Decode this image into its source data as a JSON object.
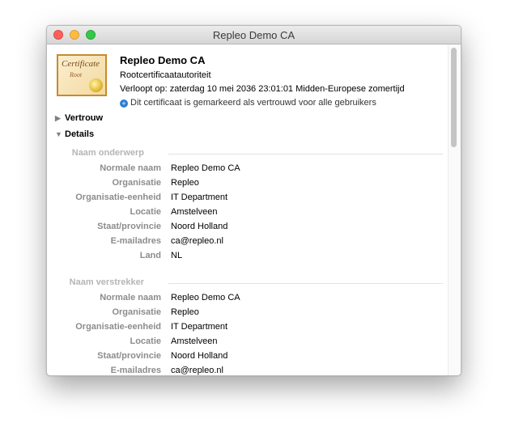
{
  "window": {
    "title": "Repleo Demo CA"
  },
  "cert": {
    "icon_text": "Certificate",
    "icon_subtext": "Root",
    "name": "Repleo Demo CA",
    "type": "Rootcertificaatautoriteit",
    "expiry": "Verloopt op: zaterdag 10 mei 2036 23:01:01 Midden-Europese zomertijd",
    "trust_status": "Dit certificaat is gemarkeerd als vertrouwd voor alle gebruikers"
  },
  "sections": {
    "trust": "Vertrouw",
    "details": "Details"
  },
  "subject": {
    "title": "Naam onderwerp",
    "rows": [
      {
        "label": "Normale naam",
        "value": "Repleo Demo CA"
      },
      {
        "label": "Organisatie",
        "value": "Repleo"
      },
      {
        "label": "Organisatie-eenheid",
        "value": "IT Department"
      },
      {
        "label": "Locatie",
        "value": "Amstelveen"
      },
      {
        "label": "Staat/provincie",
        "value": "Noord Holland"
      },
      {
        "label": "E-mailadres",
        "value": "ca@repleo.nl"
      },
      {
        "label": "Land",
        "value": "NL"
      }
    ]
  },
  "issuer": {
    "title": "Naam verstrekker",
    "rows": [
      {
        "label": "Normale naam",
        "value": "Repleo Demo CA"
      },
      {
        "label": "Organisatie",
        "value": "Repleo"
      },
      {
        "label": "Organisatie-eenheid",
        "value": "IT Department"
      },
      {
        "label": "Locatie",
        "value": "Amstelveen"
      },
      {
        "label": "Staat/provincie",
        "value": "Noord Holland"
      },
      {
        "label": "E-mailadres",
        "value": "ca@repleo.nl"
      }
    ]
  }
}
